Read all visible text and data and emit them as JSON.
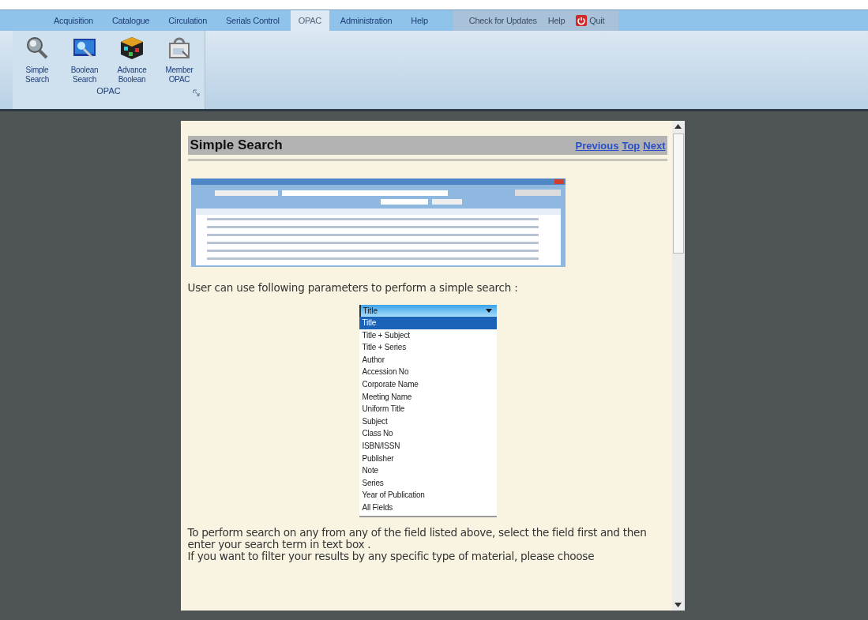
{
  "menu_tabs": [
    {
      "label": "Acquisition",
      "selected": false
    },
    {
      "label": "Catalogue",
      "selected": false
    },
    {
      "label": "Circulation",
      "selected": false
    },
    {
      "label": "Serials Control",
      "selected": false
    },
    {
      "label": "OPAC",
      "selected": true
    },
    {
      "label": "Administration",
      "selected": false
    },
    {
      "label": "Help",
      "selected": false
    }
  ],
  "quick_bar": [
    {
      "label": "Check for Updates",
      "kind": "text"
    },
    {
      "label": "Help",
      "kind": "text"
    },
    {
      "label": "Quit",
      "kind": "power"
    }
  ],
  "ribbon": {
    "group_label": "OPAC",
    "buttons": [
      {
        "label": "Simple Search",
        "kind": "magnifier"
      },
      {
        "label": "Boolean Search",
        "kind": "monitor"
      },
      {
        "label": "Advance Boolean",
        "kind": "cube"
      },
      {
        "label": "Member OPAC",
        "kind": "member"
      }
    ]
  },
  "page": {
    "heading": "Simple Search",
    "nav_links": [
      "Previous",
      "Top",
      "Next"
    ],
    "intro": "User can use following parameters to perform a simple search :",
    "dropdown": {
      "value": "Title",
      "options": [
        {
          "label": "Title",
          "selected": true
        },
        {
          "label": "Title + Subject",
          "selected": false
        },
        {
          "label": "Title + Series",
          "selected": false
        },
        {
          "label": "Author",
          "selected": false
        },
        {
          "label": "Accession No",
          "selected": false
        },
        {
          "label": "Corporate Name",
          "selected": false
        },
        {
          "label": "Meeting Name",
          "selected": false
        },
        {
          "label": "Uniform Title",
          "selected": false
        },
        {
          "label": "Subject",
          "selected": false
        },
        {
          "label": "Class No",
          "selected": false
        },
        {
          "label": "ISBN/ISSN",
          "selected": false
        },
        {
          "label": "Publisher",
          "selected": false
        },
        {
          "label": "Note",
          "selected": false
        },
        {
          "label": "Series",
          "selected": false
        },
        {
          "label": "Year of Publication",
          "selected": false
        },
        {
          "label": "All Fields",
          "selected": false
        }
      ]
    },
    "paragraphs": [
      "To perform search on any from any of the field listed above, select the field first and then enter your search term in text box .",
      "If you want to filter your results by any specific type of material, please choose"
    ]
  }
}
